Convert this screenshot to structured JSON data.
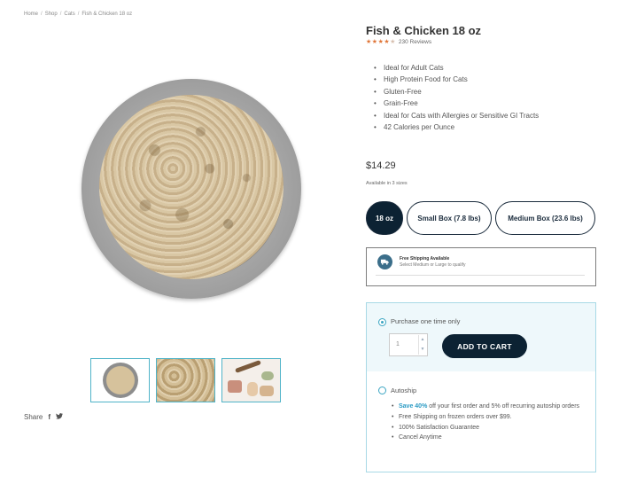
{
  "breadcrumb": [
    "Home",
    "Shop",
    "Cats",
    "Fish & Chicken 18 oz"
  ],
  "product": {
    "title": "Fish & Chicken 18 oz",
    "rating_value": 4,
    "rating_max": 5,
    "reviews": "230 Reviews",
    "features": [
      "Ideal for Adult Cats",
      "High Protein Food for Cats",
      "Gluten-Free",
      "Grain-Free",
      "Ideal for Cats with Allergies or Sensitive GI Tracts",
      "42 Calories per Ounce"
    ],
    "price": "$14.29",
    "availability": "Available in 3 sizes"
  },
  "sizes": [
    {
      "label": "18 oz",
      "selected": true
    },
    {
      "label": "Small Box (7.8 lbs)",
      "selected": false
    },
    {
      "label": "Medium Box (23.6 lbs)",
      "selected": false
    }
  ],
  "shipping": {
    "title": "Free Shipping Available",
    "subtitle": "Select Medium or Large to qualify"
  },
  "purchase": {
    "one_time_label": "Purchase one time only",
    "quantity": "1",
    "add_to_cart": "ADD TO CART",
    "autoship_label": "Autoship",
    "autoship_save": "Save 40%",
    "autoship_bullets": [
      " off your first order and 5% off recurring autoship orders",
      "Free Shipping on frozen orders over $99.",
      "100% Satisfaction Guarantee",
      "Cancel Anytime"
    ]
  },
  "share": {
    "label": "Share",
    "facebook": "f",
    "twitter": "t"
  },
  "colors": {
    "navy": "#0c2233",
    "accent": "#3aa5c2",
    "star": "#e0773a"
  },
  "icons": [
    "truck-icon",
    "facebook-icon",
    "twitter-icon",
    "star-icon"
  ]
}
